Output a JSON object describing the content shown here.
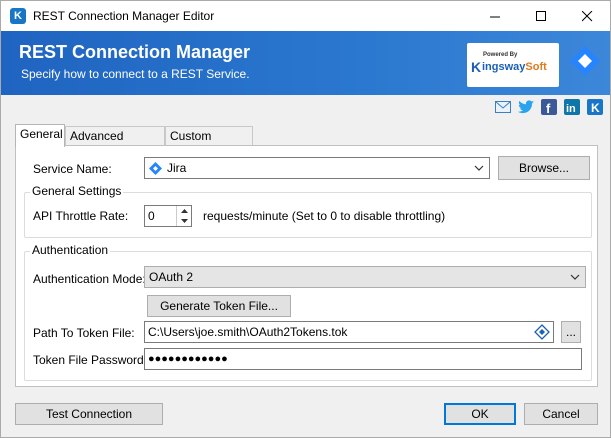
{
  "window": {
    "title": "REST Connection Manager Editor"
  },
  "banner": {
    "title": "REST Connection Manager",
    "subtitle": "Specify how to connect to a REST Service.",
    "brand_powered": "Powered By",
    "brand_k": "K",
    "brand_name_a": "ingsway",
    "brand_name_b": "Soft"
  },
  "social": [
    "mail-icon",
    "twitter-icon",
    "facebook-icon",
    "linkedin-icon",
    "kingswaysoft-icon"
  ],
  "tabs": [
    {
      "label": "General",
      "active": true
    },
    {
      "label": "Advanced Settings",
      "active": false
    },
    {
      "label": "Custom Headers",
      "active": false
    }
  ],
  "general": {
    "service_name_label": "Service Name:",
    "service_name_value": "Jira",
    "browse_label": "Browse...",
    "general_settings_title": "General Settings",
    "throttle_label": "API Throttle Rate:",
    "throttle_value": "0",
    "throttle_hint": "requests/minute (Set to 0 to disable throttling)",
    "auth_title": "Authentication",
    "auth_mode_label": "Authentication Mode:",
    "auth_mode_value": "OAuth 2",
    "generate_token_label": "Generate Token File...",
    "token_path_label": "Path To Token File:",
    "token_path_value": "C:\\Users\\joe.smith\\OAuth2Tokens.tok",
    "token_browse_label": "...",
    "token_password_label": "Token File Password:",
    "token_password_value": "●●●●●●●●●●●●"
  },
  "footer": {
    "test_label": "Test Connection",
    "ok_label": "OK",
    "cancel_label": "Cancel"
  },
  "colors": {
    "banner": "#1f64c0",
    "jira": "#2684ff",
    "accent": "#0078d7"
  }
}
